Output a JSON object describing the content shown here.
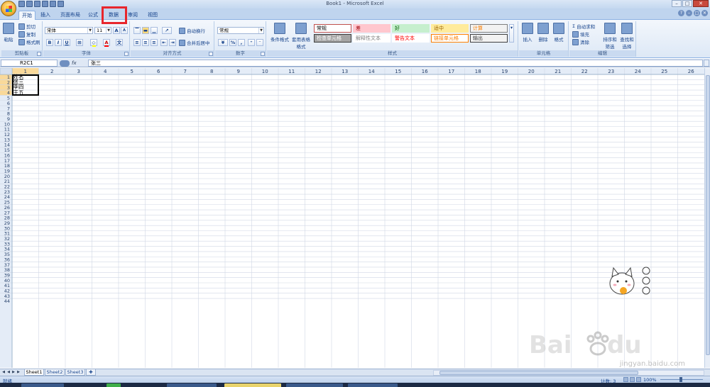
{
  "window": {
    "title": "Book1 - Microsoft Excel",
    "minimize": "–",
    "maximize": "□",
    "close": "✕"
  },
  "tabs": [
    "开始",
    "插入",
    "页面布局",
    "公式",
    "数据",
    "审阅",
    "视图"
  ],
  "active_tab": "开始",
  "help_icons": [
    "?",
    "–",
    "□",
    "✕"
  ],
  "ribbon": {
    "clipboard": {
      "label": "剪贴板",
      "paste": "粘贴",
      "cut": "剪切",
      "copy": "复制",
      "format_painter": "格式刷"
    },
    "font": {
      "label": "字体",
      "font_name": "宋体",
      "font_size": "11",
      "bold": "B",
      "italic": "I",
      "underline": "U",
      "grow": "A",
      "shrink": "A"
    },
    "alignment": {
      "label": "对齐方式",
      "wrap_text": "自动换行",
      "merge_center": "合并后居中"
    },
    "number": {
      "label": "数字",
      "format": "常规",
      "percent": "%",
      "comma": ","
    },
    "styles": {
      "label": "样式",
      "conditional_format": "条件格式",
      "table_format": "套用表格格式",
      "cells": [
        {
          "name": "常规",
          "bg": "#ffffff",
          "fg": "#000000",
          "border": "#c0504d"
        },
        {
          "name": "差",
          "bg": "#ffc7ce",
          "fg": "#9c0006",
          "border": "#ffc7ce"
        },
        {
          "name": "好",
          "bg": "#c6efce",
          "fg": "#006100",
          "border": "#c6efce"
        },
        {
          "name": "适中",
          "bg": "#ffeb9c",
          "fg": "#9c6500",
          "border": "#ffeb9c"
        },
        {
          "name": "计算",
          "bg": "#f2f2f2",
          "fg": "#fa7d00",
          "border": "#7f7f7f"
        },
        {
          "name": "检查单元格",
          "bg": "#a5a5a5",
          "fg": "#ffffff",
          "border": "#3f3f3f"
        },
        {
          "name": "解释性文本",
          "bg": "#ffffff",
          "fg": "#7f7f7f",
          "border": "#ffffff"
        },
        {
          "name": "警告文本",
          "bg": "#ffffff",
          "fg": "#ff0000",
          "border": "#ffffff"
        },
        {
          "name": "链接单元格",
          "bg": "#ffffff",
          "fg": "#fa7d00",
          "border": "#ff8001"
        },
        {
          "name": "输出",
          "bg": "#f2f2f2",
          "fg": "#3f3f3f",
          "border": "#3f3f3f"
        }
      ]
    },
    "cells": {
      "label": "单元格",
      "insert": "插入",
      "delete": "删除",
      "format": "格式"
    },
    "editing": {
      "label": "编辑",
      "autosum": "自动求和",
      "fill": "填充",
      "clear": "清除",
      "sort_filter": "排序和筛选",
      "find_select": "查找和选择"
    }
  },
  "formula_bar": {
    "name_box": "R2C1",
    "fx": "fx",
    "content": "张三"
  },
  "grid": {
    "column_headers": [
      "1",
      "2",
      "3",
      "4",
      "5",
      "6",
      "7",
      "8",
      "9",
      "10",
      "11",
      "12",
      "13",
      "14",
      "15",
      "16",
      "17",
      "18",
      "19",
      "20",
      "21",
      "22",
      "23",
      "24",
      "25",
      "26"
    ],
    "row_count": 44,
    "active_row": 2,
    "active_col": 1,
    "cells": [
      {
        "row": 1,
        "col": 1,
        "value": "姓名"
      },
      {
        "row": 2,
        "col": 1,
        "value": "张三"
      },
      {
        "row": 3,
        "col": 1,
        "value": "李四"
      },
      {
        "row": 4,
        "col": 1,
        "value": "王五"
      }
    ],
    "selection": {
      "from_row": 1,
      "to_row": 4,
      "from_col": 1,
      "to_col": 1
    }
  },
  "sheets": [
    "Sheet1",
    "Sheet2",
    "Sheet3"
  ],
  "active_sheet": "Sheet1",
  "status": {
    "ready": "就绪",
    "count": "计数: 3",
    "zoom": "100%"
  },
  "overlay": {
    "watermark_url": "jingyan.baidu.com",
    "highlight_color": "#e8262c"
  }
}
